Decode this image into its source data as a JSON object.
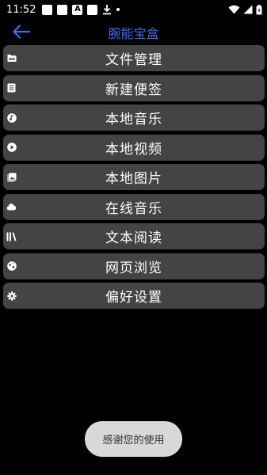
{
  "status_bar": {
    "time": "11:52",
    "notification_icons": [
      "square-icon",
      "square-icon",
      "a-letter-icon",
      "square-icon",
      "download-icon",
      "dot-icon"
    ],
    "system_icons": [
      "wifi-icon",
      "signal-icon",
      "battery-icon"
    ]
  },
  "header": {
    "title": "腕能宝盒",
    "back_icon": "arrow-left-icon"
  },
  "menu": {
    "items": [
      {
        "label": "文件管理",
        "icon": "folder-icon"
      },
      {
        "label": "新建便签",
        "icon": "note-icon"
      },
      {
        "label": "本地音乐",
        "icon": "music-note-icon"
      },
      {
        "label": "本地视频",
        "icon": "play-circle-icon"
      },
      {
        "label": "本地图片",
        "icon": "image-icon"
      },
      {
        "label": "在线音乐",
        "icon": "cloud-icon"
      },
      {
        "label": "文本阅读",
        "icon": "library-icon"
      },
      {
        "label": "网页浏览",
        "icon": "globe-icon"
      },
      {
        "label": "偏好设置",
        "icon": "gear-icon"
      }
    ]
  },
  "toast": {
    "text": "感谢您的使用"
  },
  "colors": {
    "background": "#000000",
    "item_background": "#444444",
    "title_accent": "#3e6cf0",
    "toast_background": "#d8d8d8"
  }
}
